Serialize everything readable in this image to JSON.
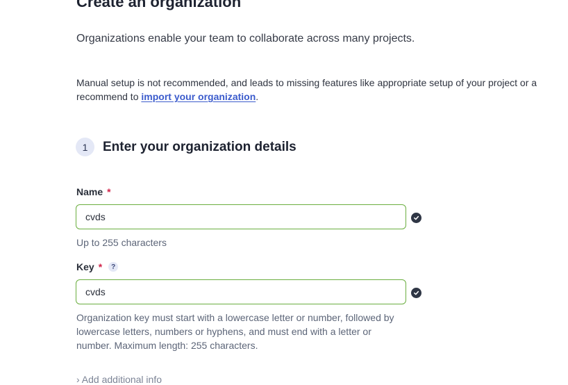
{
  "page": {
    "title": "Create an organization",
    "intro": "Organizations enable your team to collaborate across many projects.",
    "warning": {
      "line1": "Manual setup is not recommended, and leads to missing features like appropriate setup of your project or a",
      "line2_prefix": "recommend to ",
      "link": "import your organization",
      "line2_suffix": "."
    }
  },
  "step": {
    "number": "1",
    "title": "Enter your organization details"
  },
  "form": {
    "name": {
      "label": "Name",
      "required_mark": "*",
      "value": "cvds",
      "hint": "Up to 255 characters"
    },
    "key": {
      "label": "Key",
      "required_mark": "*",
      "help_icon": "?",
      "value": "cvds",
      "hint_lines": [
        "Organization key must start with a lowercase letter or number, followed by",
        "lowercase letters, numbers or hyphens, and must end with a letter or",
        "number. Maximum length: 255 characters."
      ]
    },
    "additional_info": "Add additional info"
  },
  "colors": {
    "valid_border": "#6aae3f",
    "required": "#d1244a",
    "link": "#3b5bcc"
  }
}
